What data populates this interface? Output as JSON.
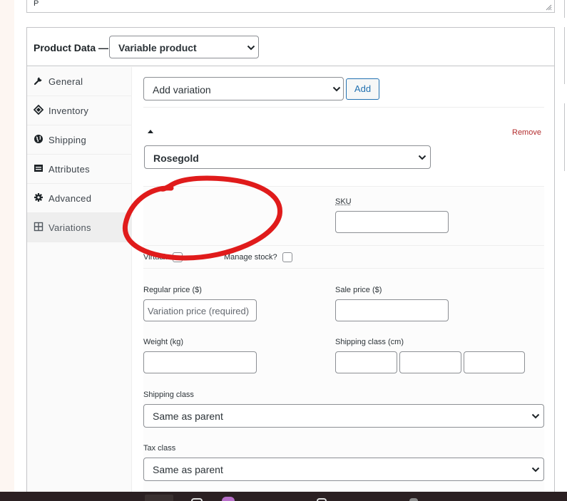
{
  "top_textarea": {
    "text": "P"
  },
  "product_data": {
    "title": "Product Data —",
    "type_select": "Variable product"
  },
  "sidebar": {
    "items": [
      {
        "label": "General",
        "icon": "wrench-icon",
        "active": false
      },
      {
        "label": "Inventory",
        "icon": "tag-icon",
        "active": false
      },
      {
        "label": "Shipping",
        "icon": "globe-icon",
        "active": false
      },
      {
        "label": "Attributes",
        "icon": "list-icon",
        "active": false
      },
      {
        "label": "Advanced",
        "icon": "gear-icon",
        "active": false
      },
      {
        "label": "Variations",
        "icon": "grid-icon",
        "active": true
      }
    ]
  },
  "variations": {
    "add_select": "Add variation",
    "add_button": "Add",
    "remove_link": "Remove",
    "attribute_select": "Rosegold",
    "sku_label": "SKU",
    "virtual_label": "Virtual:",
    "manage_stock_label": "Manage stock?",
    "regular_price_label": "Regular price ($)",
    "regular_price_placeholder": "Variation price (required)",
    "sale_price_label": "Sale price ($)",
    "weight_label": "Weight (kg)",
    "dimensions_label": "Shipping class (cm)",
    "shipping_class_label": "Shipping class",
    "shipping_class_value": "Same as parent",
    "tax_class_label": "Tax class",
    "tax_class_value": "Same as parent"
  },
  "colors": {
    "accent": "#2271b1",
    "remove": "#b32d2e",
    "annotation": "#e01b1b"
  }
}
